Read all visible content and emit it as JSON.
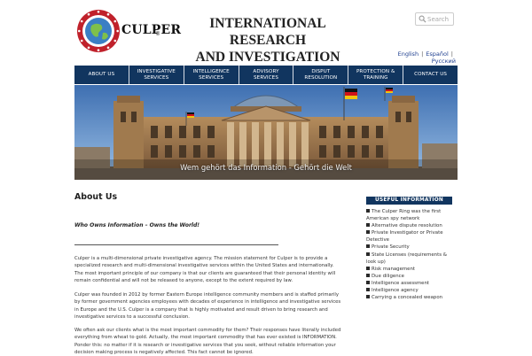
{
  "header": {
    "logo_text": "CULPER",
    "logo_reg": "®",
    "title_line1": "INTERNATIONAL RESEARCH",
    "title_line2": "AND INVESTIGATION"
  },
  "search": {
    "placeholder": "Search",
    "icon": "search-icon"
  },
  "languages": {
    "items": [
      "English",
      "Español",
      "Русский"
    ],
    "separator": "|"
  },
  "nav": {
    "items": [
      "ABOUT US",
      "INVESTIGATIVE SERVICES",
      "INTELLIGENCE SERVICES",
      "ADVISORY SERVICES",
      "DISPUT RESOLUTION",
      "PROTECTION & TRAINING",
      "CONTACT US"
    ]
  },
  "banner": {
    "caption": "Wem gehört das Information - Gehört die Welt"
  },
  "main": {
    "title": "About Us",
    "tagline": "Who Owns Information – Owns the World!",
    "paragraphs": [
      "Culper is a multi-dimensional private investigative agency. The mission statement for Culper is to provide a specialized research and multi-dimensional investigative services within the United States and internationally. The most important principle of our company is that our clients are guaranteed that their personal identity will remain confidential and will not be released to anyone, except to the extent required by law.",
      "Culper was founded in 2012 by former Eastern Europe intelligence community members and is staffed primarily by former government agencies employees with decades of experience in intelligence and investigative services in Europe and the U.S. Culper is a company that is highly motivated and result driven to bring research and investigative services to a successful conclusion.",
      "We often ask our clients what is the most important commodity for them? Their responses have literally included everything from wheat to gold. Actually, the most important commodity that has ever existed is INFORMATION. Ponder this: no matter if it is research or investigative services that you seek, without reliable information your decision making process is negatively affected. This fact cannot be ignored."
    ]
  },
  "sidebar": {
    "heading": "USEFUL INFORMATION",
    "items": [
      "The Culper Ring was the first American spy network",
      "Alternative dispute resolution",
      "Private Investigator or Private Detective",
      "Private Security",
      "State Licenses (requirements & look up)",
      "Risk management",
      "Due diligence",
      "Intelligence assessment",
      "Intelligence agency",
      "Carrying a concealed weapon"
    ]
  },
  "colors": {
    "nav_bg": "#11355f",
    "link": "#1f3f8f",
    "logo_ring": "#c0212b",
    "globe": "#3b7fc4"
  }
}
